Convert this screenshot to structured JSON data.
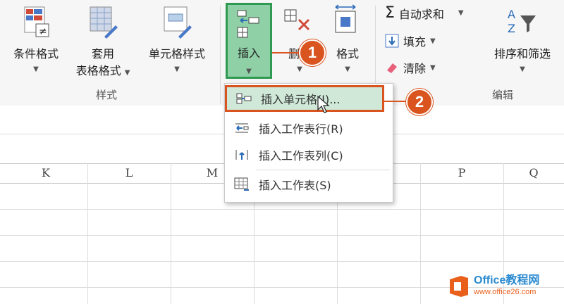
{
  "ribbon": {
    "styles_group": {
      "label": "样式",
      "conditional_format": "条件格式",
      "table_format_line1": "套用",
      "table_format_line2": "表格格式",
      "cell_styles": "单元格样式"
    },
    "cells_group": {
      "insert": "插入",
      "delete": "删除",
      "format": "格式"
    },
    "editing_group": {
      "label": "编辑",
      "autosum": "自动求和",
      "fill": "填充",
      "clear": "清除",
      "sort_filter": "排序和筛选"
    }
  },
  "insert_menu": {
    "items": [
      {
        "label": "插入单元格(I)..."
      },
      {
        "label": "插入工作表行(R)"
      },
      {
        "label": "插入工作表列(C)"
      },
      {
        "label": "插入工作表(S)"
      }
    ]
  },
  "sheet": {
    "columns": [
      "K",
      "L",
      "M",
      "P",
      "Q"
    ]
  },
  "callouts": {
    "one": "1",
    "two": "2"
  },
  "watermark": {
    "brand": "Office教程网",
    "url": "www.office26.com"
  },
  "colors": {
    "accent_green": "#2e9a52",
    "callout": "#d9541e",
    "highlight": "#cfe8d8"
  }
}
